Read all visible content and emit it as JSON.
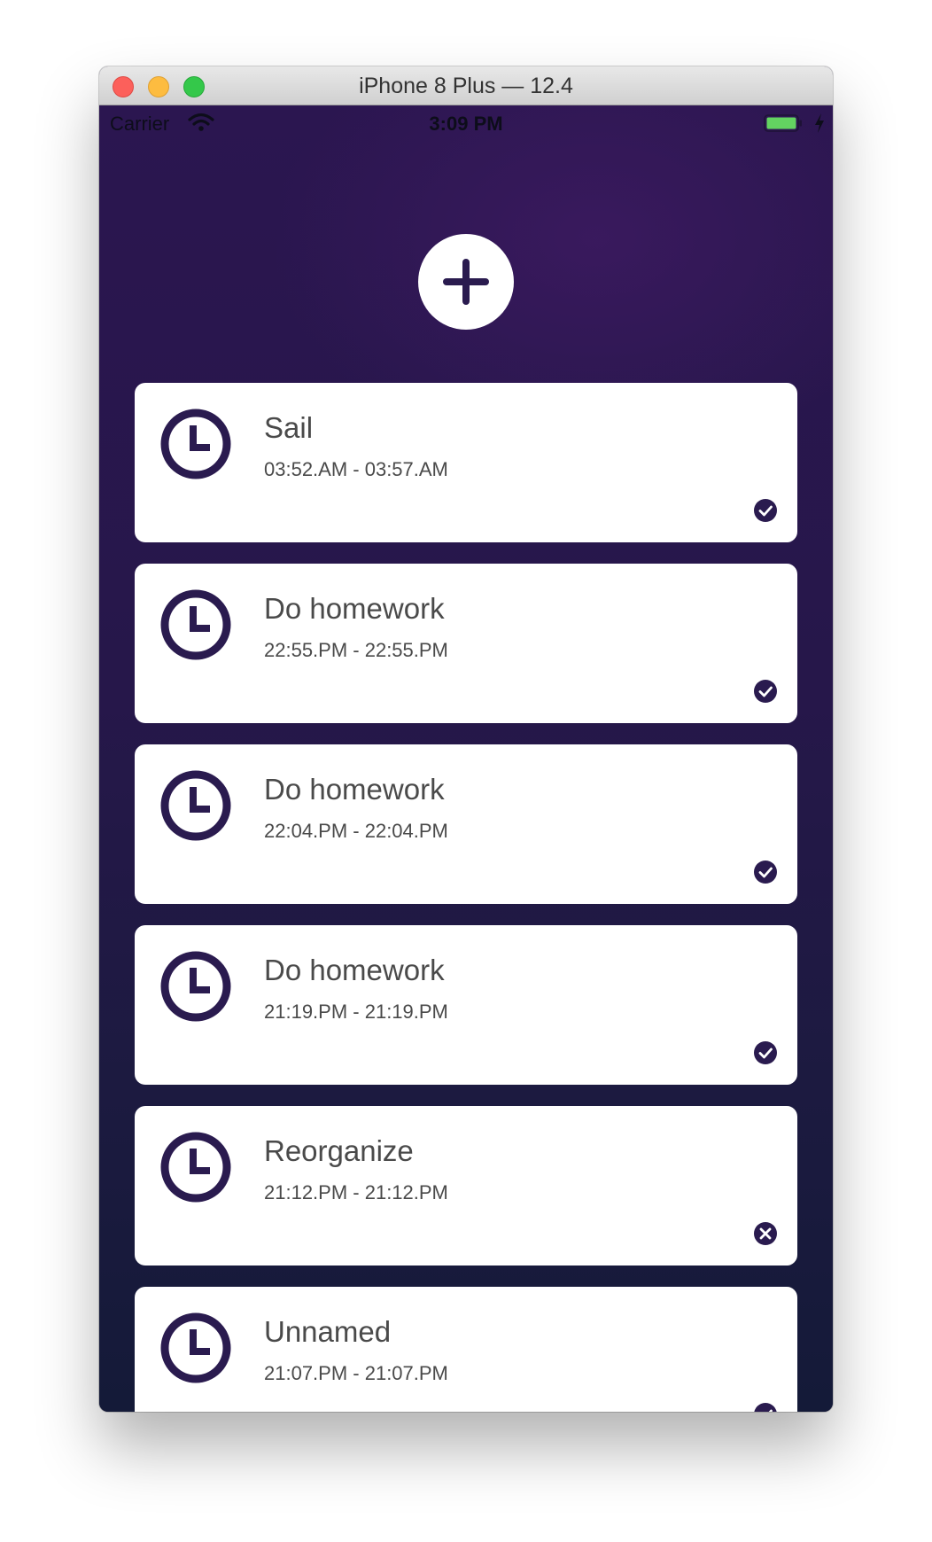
{
  "window": {
    "title": "iPhone 8 Plus — 12.4"
  },
  "statusbar": {
    "carrier": "Carrier",
    "time": "3:09 PM",
    "battery_color": "#63d361"
  },
  "colors": {
    "accent": "#2a1b4f",
    "card": "#ffffff",
    "text": "#4a4a4a"
  },
  "tasks": [
    {
      "title": "Sail",
      "time": "03:52.AM - 03:57.AM",
      "status": "done",
      "status_icon": "check-circle-icon"
    },
    {
      "title": "Do homework",
      "time": "22:55.PM - 22:55.PM",
      "status": "done",
      "status_icon": "check-circle-icon"
    },
    {
      "title": "Do homework",
      "time": "22:04.PM - 22:04.PM",
      "status": "done",
      "status_icon": "check-circle-icon"
    },
    {
      "title": "Do homework",
      "time": "21:19.PM - 21:19.PM",
      "status": "done",
      "status_icon": "check-circle-icon"
    },
    {
      "title": "Reorganize",
      "time": "21:12.PM - 21:12.PM",
      "status": "failed",
      "status_icon": "x-circle-icon"
    },
    {
      "title": "Unnamed",
      "time": "21:07.PM - 21:07.PM",
      "status": "done",
      "status_icon": "check-circle-icon"
    }
  ]
}
